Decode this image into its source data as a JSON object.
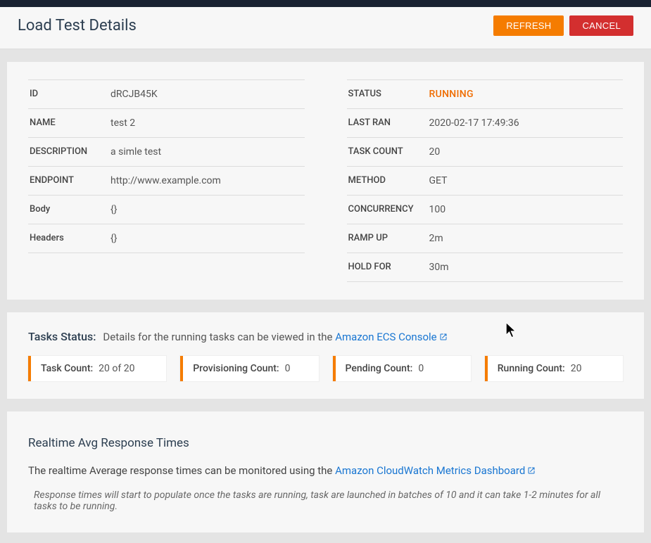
{
  "header": {
    "title": "Load Test Details",
    "refresh_label": "REFRESH",
    "cancel_label": "CANCEL"
  },
  "details_left": [
    {
      "label": "ID",
      "value": "dRCJB45K"
    },
    {
      "label": "NAME",
      "value": "test 2"
    },
    {
      "label": "DESCRIPTION",
      "value": "a simle test"
    },
    {
      "label": "ENDPOINT",
      "value": "http://www.example.com"
    },
    {
      "label": "Body",
      "value": "{}"
    },
    {
      "label": "Headers",
      "value": "{}"
    }
  ],
  "details_right": [
    {
      "label": "STATUS",
      "value": "RUNNING",
      "highlight": true
    },
    {
      "label": "LAST RAN",
      "value": "2020-02-17 17:49:36"
    },
    {
      "label": "TASK COUNT",
      "value": "20"
    },
    {
      "label": "METHOD",
      "value": "GET"
    },
    {
      "label": "CONCURRENCY",
      "value": "100"
    },
    {
      "label": "RAMP UP",
      "value": "2m"
    },
    {
      "label": "HOLD FOR",
      "value": "30m"
    }
  ],
  "tasks": {
    "title": "Tasks Status:",
    "subtitle_prefix": "Details for the running tasks can be viewed in the ",
    "link_text": "Amazon ECS Console",
    "counts": [
      {
        "label": "Task Count:",
        "value": "20 of 20"
      },
      {
        "label": "Provisioning Count:",
        "value": "0"
      },
      {
        "label": "Pending Count:",
        "value": "0"
      },
      {
        "label": "Running Count:",
        "value": "20"
      }
    ]
  },
  "realtime": {
    "title": "Realtime Avg Response Times",
    "text_prefix": "The realtime Average response times can be monitored using the ",
    "link_text": "Amazon CloudWatch Metrics Dashboard",
    "note": "Response times will start to populate once the tasks are running, task are launched in batches of 10 and it can take 1-2 minutes for all tasks to be running."
  }
}
